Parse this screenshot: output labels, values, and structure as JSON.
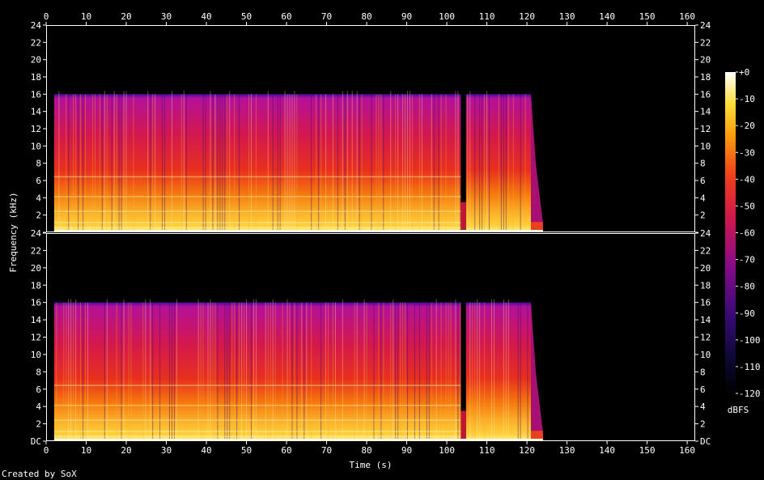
{
  "chart_data": {
    "type": "heatmap",
    "xlabel": "Time (s)",
    "ylabel": "Frequency (kHz)",
    "x_ticks": [
      0,
      10,
      20,
      30,
      40,
      50,
      60,
      70,
      80,
      90,
      100,
      110,
      120,
      130,
      140,
      150,
      160
    ],
    "xlim": [
      0,
      162
    ],
    "ylim_khz": [
      0,
      24
    ],
    "y_tick_labels": [
      "DC",
      "2",
      "4",
      "6",
      "8",
      "10",
      "12",
      "14",
      "16",
      "18",
      "20",
      "22",
      "24"
    ],
    "channels": 2,
    "content_start_s": 2,
    "content_end_s": 124,
    "fade_out_start_s": 121,
    "lowpass_cutoff_khz": 16,
    "gap_s": [
      103.5,
      104.8
    ],
    "colorbar": {
      "label": "dBFS",
      "range": [
        -120,
        0
      ],
      "ticks": [
        "+0",
        "-10",
        "-20",
        "-30",
        "-40",
        "-50",
        "-60",
        "-70",
        "-80",
        "-90",
        "-100",
        "-110",
        "-120"
      ]
    },
    "grid": false,
    "credit": "Created by SoX"
  }
}
